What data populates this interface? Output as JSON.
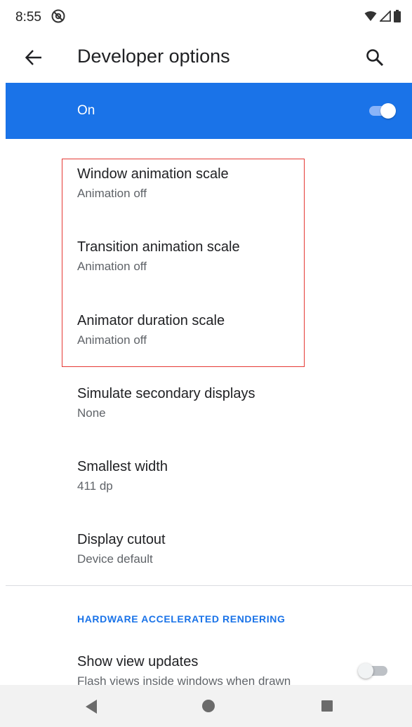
{
  "status_bar": {
    "time": "8:55",
    "icons": [
      "notification-status-icon",
      "wifi-icon",
      "cell-signal-icon",
      "battery-icon"
    ]
  },
  "app_bar": {
    "title": "Developer options",
    "icons": [
      "back-arrow-icon",
      "search-icon"
    ]
  },
  "master_switch": {
    "label": "On",
    "enabled": true,
    "color": "#1a73e8"
  },
  "settings": [
    {
      "title": "Window animation scale",
      "summary": "Animation off"
    },
    {
      "title": "Transition animation scale",
      "summary": "Animation off"
    },
    {
      "title": "Animator duration scale",
      "summary": "Animation off"
    },
    {
      "title": "Simulate secondary displays",
      "summary": "None"
    },
    {
      "title": "Smallest width",
      "summary": "411 dp"
    },
    {
      "title": "Display cutout",
      "summary": "Device default"
    }
  ],
  "category": {
    "header": "HARDWARE ACCELERATED RENDERING",
    "color": "#1a73e8"
  },
  "show_view_updates": {
    "title": "Show view updates",
    "summary": "Flash views inside windows when drawn",
    "enabled": false
  },
  "nav_bar": {
    "icons": [
      "nav-back-icon",
      "nav-home-icon",
      "nav-recents-icon"
    ]
  },
  "colors": {
    "highlight_border": "#e53935",
    "text_primary": "#202124",
    "text_secondary": "#5f6368"
  }
}
